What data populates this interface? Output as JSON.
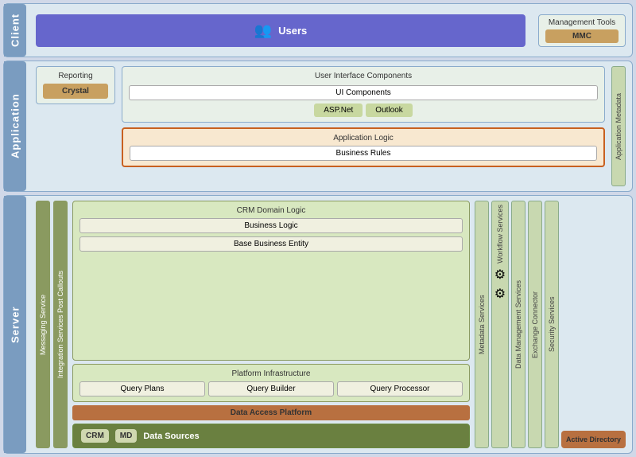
{
  "layers": {
    "client": {
      "label": "Client",
      "users": {
        "icon": "👥",
        "label": "Users"
      },
      "management": {
        "title": "Management Tools",
        "mmc": "MMC"
      }
    },
    "application": {
      "label": "Application",
      "reporting": {
        "title": "Reporting",
        "crystal": "Crystal"
      },
      "ui_components": {
        "title": "User Interface Components",
        "ui": "UI Components",
        "aspnet": "ASP.Net",
        "outlook": "Outlook"
      },
      "app_logic": {
        "title": "Application Logic",
        "rules": "Business Rules"
      },
      "metadata": "Application Metadata"
    },
    "server": {
      "label": "Server",
      "messaging": "Messaging Service",
      "integration": "Integration Services Post Callouts",
      "crm_domain": {
        "title": "CRM Domain Logic",
        "business_logic": "Business Logic",
        "base_entity": "Base Business Entity"
      },
      "platform": {
        "title": "Platform Infrastructure",
        "query_plans": "Query Plans",
        "query_builder": "Query Builder",
        "query_processor": "Query Processor"
      },
      "data_access": "Data Access Platform",
      "data_sources": {
        "label": "Data Sources",
        "crm": "CRM",
        "md": "MD"
      },
      "metadata_services": "Metadata Services",
      "workflow_services": "Workflow Services",
      "data_mgmt": "Data Management Services",
      "exchange": "Exchange Connector",
      "security": "Security Services",
      "active_directory": "Active Directory"
    }
  }
}
